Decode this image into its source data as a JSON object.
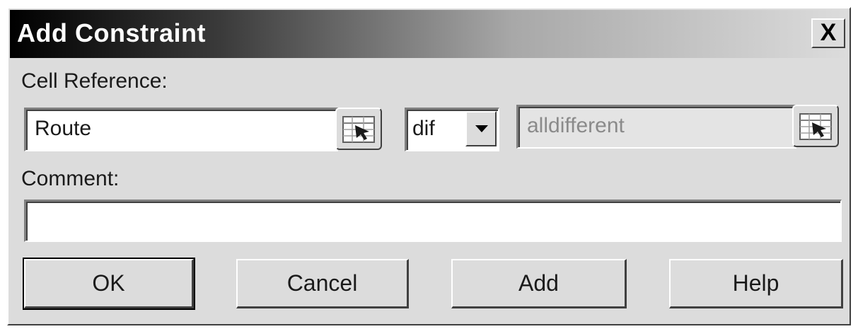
{
  "dialog": {
    "title": "Add Constraint",
    "close_label": "X"
  },
  "cell_reference": {
    "label": "Cell Reference:",
    "value": "Route"
  },
  "operator": {
    "selected": "dif"
  },
  "constraint": {
    "value": "alldifferent",
    "disabled": true
  },
  "comment": {
    "label": "Comment:",
    "value": ""
  },
  "buttons": {
    "ok": "OK",
    "cancel": "Cancel",
    "add": "Add",
    "help": "Help"
  },
  "icons": {
    "ref_picker": "collapse-dialog-icon",
    "dropdown": "triangle-down-icon"
  }
}
